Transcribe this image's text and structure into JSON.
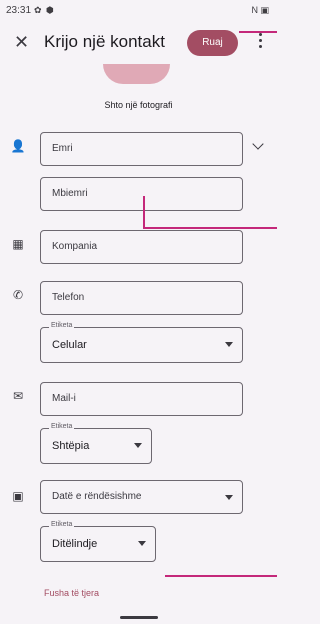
{
  "status": {
    "time": "23:31",
    "right_icons": "N ▣"
  },
  "header": {
    "close_icon": "close-icon",
    "title": "Krijo një kontakt",
    "save": "Ruaj",
    "more_icon": "more-vert-icon"
  },
  "photo": {
    "label": "Shto një fotografi"
  },
  "fields": {
    "first_name": "Emri",
    "last_name": "Mbiemri",
    "company": "Kompania",
    "phone": "Telefon",
    "phone_label_caption": "Etiketa",
    "phone_label_value": "Celular",
    "email": "Mail-i",
    "email_label_caption": "Etiketa",
    "email_label_value": "Shtëpia",
    "date": "Datë e rëndësishme",
    "date_label_caption": "Etiketa",
    "date_label_value": "Ditëlindje"
  },
  "footer": {
    "more_fields": "Fusha të tjera"
  },
  "colors": {
    "accent": "#a34d63",
    "annotation": "#c4287a",
    "background": "#f6f3f7"
  }
}
